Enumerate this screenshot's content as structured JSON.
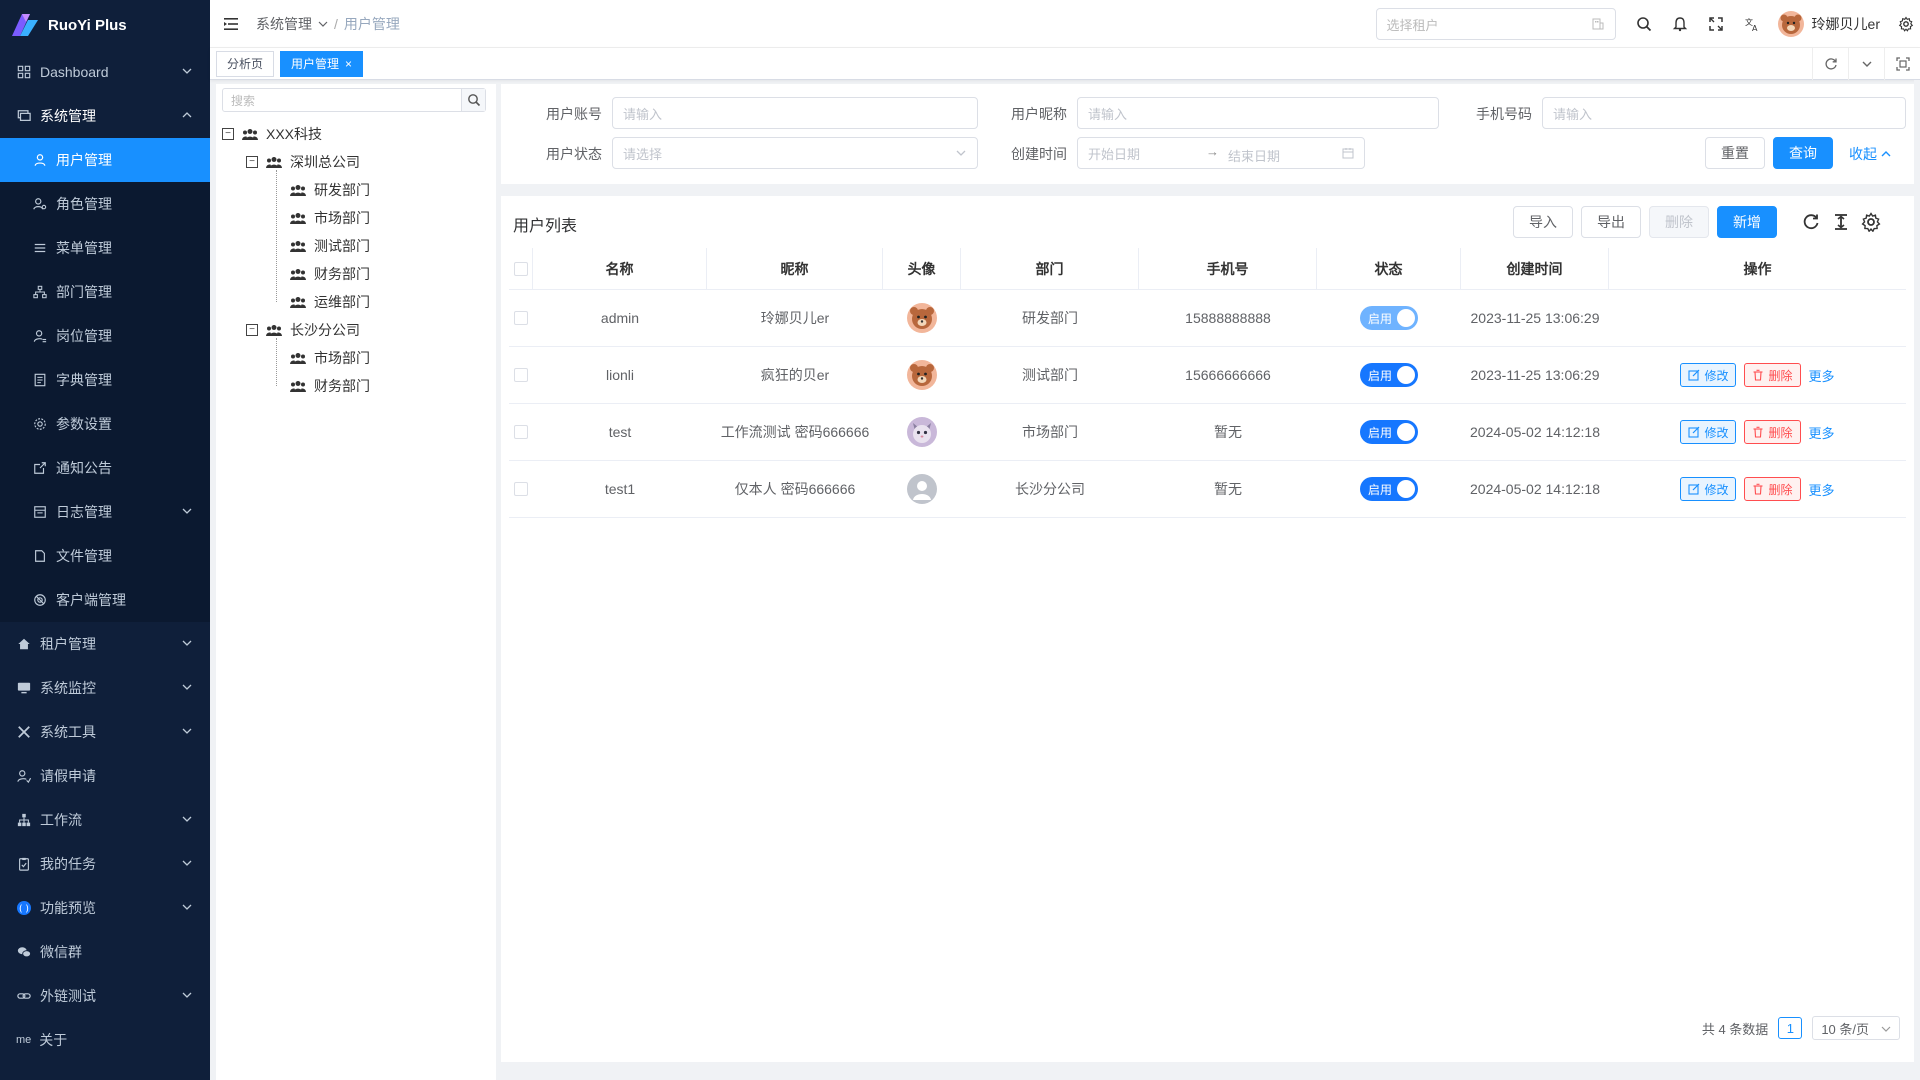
{
  "app": {
    "name": "RuoYi Plus"
  },
  "sidebar": {
    "items": [
      {
        "label": "Dashboard",
        "icon": "dashboard-icon",
        "chevron": "down"
      },
      {
        "label": "系统管理",
        "icon": "system-icon",
        "chevron": "up",
        "open": true
      },
      {
        "label": "用户管理",
        "icon": "user-icon",
        "sub": true,
        "active": true
      },
      {
        "label": "角色管理",
        "icon": "role-icon",
        "sub": true
      },
      {
        "label": "菜单管理",
        "icon": "menu-icon",
        "sub": true
      },
      {
        "label": "部门管理",
        "icon": "tree-icon",
        "sub": true
      },
      {
        "label": "岗位管理",
        "icon": "post-icon",
        "sub": true
      },
      {
        "label": "字典管理",
        "icon": "dict-icon",
        "sub": true
      },
      {
        "label": "参数设置",
        "icon": "settings-icon",
        "sub": true
      },
      {
        "label": "通知公告",
        "icon": "notice-icon",
        "sub": true
      },
      {
        "label": "日志管理",
        "icon": "log-icon",
        "sub": true,
        "chevron": "down"
      },
      {
        "label": "文件管理",
        "icon": "file-icon",
        "sub": true
      },
      {
        "label": "客户端管理",
        "icon": "client-icon",
        "sub": true
      },
      {
        "label": "租户管理",
        "icon": "tenant-icon",
        "chevron": "down"
      },
      {
        "label": "系统监控",
        "icon": "monitor-icon",
        "chevron": "down"
      },
      {
        "label": "系统工具",
        "icon": "tool-icon",
        "chevron": "down"
      },
      {
        "label": "请假申请",
        "icon": "leave-icon"
      },
      {
        "label": "工作流",
        "icon": "workflow-icon",
        "chevron": "down"
      },
      {
        "label": "我的任务",
        "icon": "task-icon",
        "chevron": "down"
      },
      {
        "label": "功能预览",
        "icon": "preview-icon",
        "chevron": "down"
      },
      {
        "label": "微信群",
        "icon": "wechat-icon"
      },
      {
        "label": "外链测试",
        "icon": "link-icon",
        "chevron": "down"
      },
      {
        "label": "关于",
        "icon": "me-icon",
        "icon_text": "me"
      }
    ]
  },
  "header": {
    "breadcrumb": [
      "系统管理",
      "用户管理"
    ],
    "tenant_placeholder": "选择租户",
    "user_name": "玲娜贝儿er"
  },
  "tags": [
    {
      "label": "分析页",
      "active": false
    },
    {
      "label": "用户管理",
      "active": true,
      "close": "×"
    }
  ],
  "dept_tree": {
    "search_placeholder": "搜索",
    "nodes": [
      {
        "label": "XXX科技",
        "level": 0,
        "toggle": "−"
      },
      {
        "label": "深圳总公司",
        "level": 1,
        "toggle": "−"
      },
      {
        "label": "研发部门",
        "level": 2
      },
      {
        "label": "市场部门",
        "level": 2
      },
      {
        "label": "测试部门",
        "level": 2
      },
      {
        "label": "财务部门",
        "level": 2
      },
      {
        "label": "运维部门",
        "level": 2
      },
      {
        "label": "长沙分公司",
        "level": 1,
        "toggle": "−"
      },
      {
        "label": "市场部门",
        "level": 2
      },
      {
        "label": "财务部门",
        "level": 2
      }
    ]
  },
  "search_form": {
    "account_label": "用户账号",
    "account_placeholder": "请输入",
    "nickname_label": "用户昵称",
    "nickname_placeholder": "请输入",
    "phone_label": "手机号码",
    "phone_placeholder": "请输入",
    "status_label": "用户状态",
    "status_placeholder": "请选择",
    "created_label": "创建时间",
    "start_placeholder": "开始日期",
    "range_sep": "→",
    "end_placeholder": "结束日期",
    "reset_label": "重置",
    "query_label": "查询",
    "collapse_label": "收起"
  },
  "user_table": {
    "title": "用户列表",
    "buttons": {
      "import": "导入",
      "export": "导出",
      "delete": "删除",
      "add": "新增"
    },
    "columns": [
      "名称",
      "昵称",
      "头像",
      "部门",
      "手机号",
      "状态",
      "创建时间",
      "操作"
    ],
    "rows": [
      {
        "name": "admin",
        "nickname": "玲娜贝儿er",
        "avatar": "bear",
        "dept": "研发部门",
        "phone": "15888888888",
        "status": "启用",
        "created": "2023-11-25 13:06:29",
        "ops": false
      },
      {
        "name": "lionli",
        "nickname": "疯狂的贝er",
        "avatar": "bear",
        "dept": "测试部门",
        "phone": "15666666666",
        "status": "启用",
        "created": "2023-11-25 13:06:29",
        "ops": true
      },
      {
        "name": "test",
        "nickname": "工作流测试 密码666666",
        "avatar": "cat",
        "dept": "市场部门",
        "phone": "暂无",
        "status": "启用",
        "created": "2024-05-02 14:12:18",
        "ops": true
      },
      {
        "name": "test1",
        "nickname": "仅本人 密码666666",
        "avatar": "default",
        "dept": "长沙分公司",
        "phone": "暂无",
        "status": "启用",
        "created": "2024-05-02 14:12:18",
        "ops": true
      }
    ],
    "op_labels": {
      "edit": "修改",
      "delete": "删除",
      "more": "更多"
    }
  },
  "pagination": {
    "total_text": "共 4 条数据",
    "current_page": "1",
    "page_size": "10 条/页"
  },
  "colors": {
    "primary": "#1890ff",
    "sidebar_bg": "#0f1f3a",
    "danger": "#ff4d4f"
  }
}
